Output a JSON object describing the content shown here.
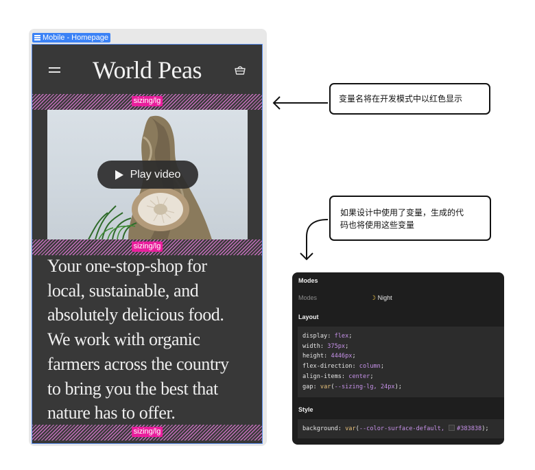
{
  "frame": {
    "label": "Mobile - Homepage",
    "brand_title": "World Peas",
    "spacer_tag": "sizing/lg",
    "play_button_label": "Play video",
    "body_lines": [
      "Your one-stop-shop for",
      "local, sustainable, and",
      "absolutely delicious food.",
      "We work with organic",
      "farmers across the country",
      "to bring you the best that",
      "nature has to offer."
    ]
  },
  "callouts": {
    "variable_name_note": "变量名将在开发模式中以红色显示",
    "code_note_line1": "如果设计中使用了变量，生成的代",
    "code_note_line2": "码也将使用这些变量"
  },
  "dev_panel": {
    "modes_title": "Modes",
    "modes_label": "Modes",
    "modes_value": "Night",
    "layout_title": "Layout",
    "layout_code": [
      {
        "prop": "display",
        "value": "flex",
        "fn": ""
      },
      {
        "prop": "width",
        "value": "375px",
        "fn": ""
      },
      {
        "prop": "height",
        "value": "4446px",
        "fn": ""
      },
      {
        "prop": "flex-direction",
        "value": "column",
        "fn": ""
      },
      {
        "prop": "align-items",
        "value": "center",
        "fn": ""
      },
      {
        "prop": "gap",
        "value": "--sizing-lg, 24px",
        "fn": "var"
      }
    ],
    "style_title": "Style",
    "style_prop": "background",
    "style_fn": "var",
    "style_var": "--color-surface-default,",
    "style_hex": "#383838"
  },
  "colors": {
    "frame_bg": "#383838",
    "spacer_tag_bg": "#e91e9c",
    "selection_blue": "#3b82f6",
    "code_value": "#c792ea",
    "code_fn": "#e6c07b"
  }
}
